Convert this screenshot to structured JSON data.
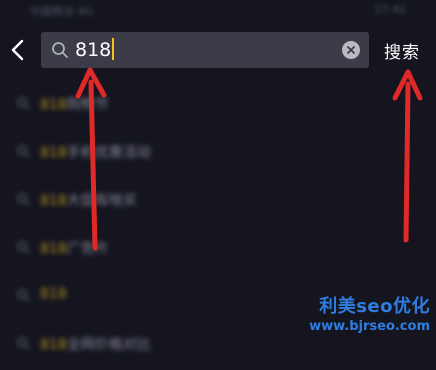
{
  "status_bar": {
    "left": "中国移动 4G",
    "right": "17:42"
  },
  "search": {
    "query": "818"
  },
  "header": {
    "search_button": "搜索"
  },
  "suggestions": [
    {
      "highlight": "818",
      "rest": "购物节"
    },
    {
      "highlight": "818",
      "rest": "手机优惠活动"
    },
    {
      "highlight": "818",
      "rest": "大促有啥买"
    },
    {
      "highlight": "818",
      "rest": "广告片"
    },
    {
      "highlight": "818",
      "rest": ""
    },
    {
      "highlight": "818",
      "rest": "全网价格对比"
    }
  ],
  "watermark": {
    "line1": "利美seo优化",
    "line2": "www.bjrseo.com"
  },
  "colors": {
    "annotation_arrow": "#e02a2a",
    "highlight": "#c9a320",
    "watermark": "#2f7de1"
  },
  "icons": {
    "back": "chevron-left-icon",
    "search": "search-icon",
    "clear": "clear-icon",
    "history": "search-history-icon"
  }
}
